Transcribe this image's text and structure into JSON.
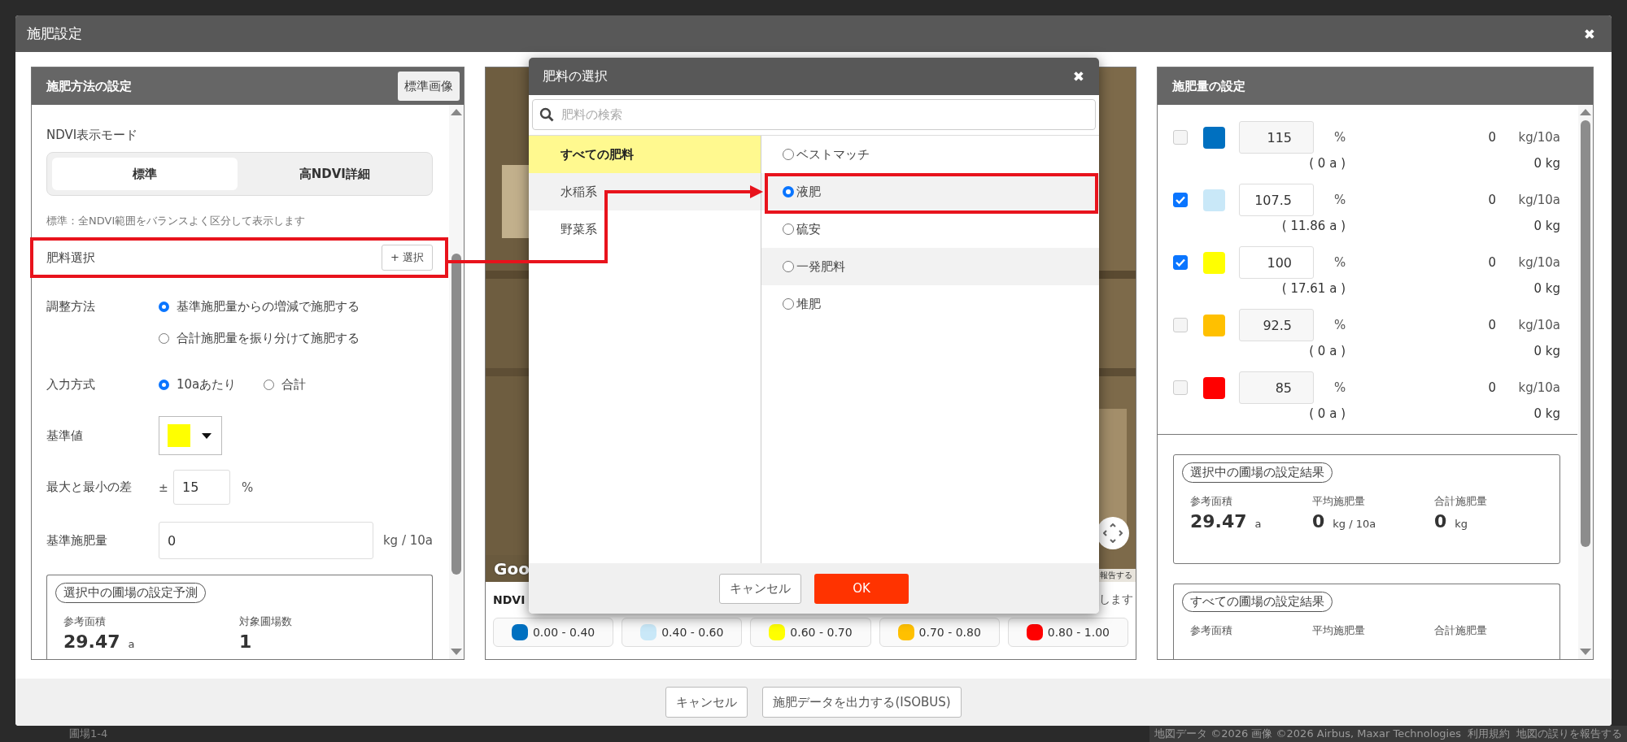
{
  "backdrop": {
    "list_item": "圃場1-4",
    "map_footer": [
      "地図データ ©2026 画像 ©2026 Airbus, Maxar Technologies",
      "利用規約",
      "地図の誤りを報告する"
    ]
  },
  "window": {
    "title": "施肥設定",
    "close": "✖"
  },
  "method_panel": {
    "title": "施肥方法の設定",
    "header_button": "標準画像",
    "ndvi_mode": {
      "label": "NDVI表示モード",
      "options": [
        {
          "label": "標準",
          "selected": true
        },
        {
          "label": "高NDVI詳細",
          "selected": false
        }
      ],
      "note": "標準：全NDVI範囲をバランスよく区分して表示します"
    },
    "fertilizer": {
      "label": "肥料選択",
      "button": "+ 選択"
    },
    "adjust": {
      "label": "調整方法",
      "options": [
        {
          "label": "基準施肥量からの増減で施肥する",
          "selected": true
        },
        {
          "label": "合計施肥量を振り分けて施肥する",
          "selected": false
        }
      ]
    },
    "input_mode": {
      "label": "入力方式",
      "options": [
        {
          "label": "10aあたり",
          "selected": true
        },
        {
          "label": "合計",
          "selected": false
        }
      ]
    },
    "base": {
      "label": "基準値",
      "color": "#ffff00"
    },
    "range": {
      "label": "最大と最小の差",
      "prefix": "±",
      "value": "15",
      "unit": "%"
    },
    "base_amount": {
      "label": "基準施肥量",
      "value": "0",
      "unit": "kg / 10a"
    },
    "forecast": {
      "title": "選択中の圃場の設定予測",
      "stats": [
        {
          "label": "参考面積",
          "value": "29.47",
          "unit": "a"
        },
        {
          "label": "対象圃場数",
          "value": "1"
        }
      ]
    }
  },
  "map_panel": {
    "kind": "picture",
    "logo": "Goo",
    "report": "報告する",
    "legend_title": "NDVI",
    "note_tail": "します",
    "ranges": [
      {
        "label": "0.00 - 0.40",
        "color": "#0070c0"
      },
      {
        "label": "0.40 - 0.60",
        "color": "#c9e8f8"
      },
      {
        "label": "0.60 - 0.70",
        "color": "#ffff00"
      },
      {
        "label": "0.70 - 0.80",
        "color": "#ffc000"
      },
      {
        "label": "0.80 - 1.00",
        "color": "#ff0000"
      }
    ]
  },
  "fertilizer_dialog": {
    "title": "肥料の選択",
    "close": "✖",
    "search_placeholder": "肥料の検索",
    "categories": [
      {
        "label": "すべての肥料",
        "selected": true
      },
      {
        "label": "水稲系",
        "selected": false
      },
      {
        "label": "野菜系",
        "selected": false
      }
    ],
    "fertilizers": [
      {
        "label": "ベストマッチ",
        "selected": false
      },
      {
        "label": "液肥",
        "selected": true
      },
      {
        "label": "硫安",
        "selected": false
      },
      {
        "label": "一発肥料",
        "selected": false
      },
      {
        "label": "堆肥",
        "selected": false
      }
    ],
    "cancel": "キャンセル",
    "ok": "OK"
  },
  "amount_panel": {
    "title": "施肥量の設定",
    "rows": [
      {
        "checked": false,
        "color": "#0070c0",
        "percent": "115",
        "percent_unit": "%",
        "area": "( 0 a )",
        "rate": "0",
        "rate_unit": "kg/10a",
        "total": "0 kg"
      },
      {
        "checked": true,
        "color": "#c9e8f8",
        "percent": "107.5",
        "percent_unit": "%",
        "area": "( 11.86 a )",
        "rate": "0",
        "rate_unit": "kg/10a",
        "total": "0 kg"
      },
      {
        "checked": true,
        "color": "#ffff00",
        "percent": "100",
        "percent_unit": "%",
        "area": "( 17.61 a )",
        "rate": "0",
        "rate_unit": "kg/10a",
        "total": "0 kg"
      },
      {
        "checked": false,
        "color": "#ffc000",
        "percent": "92.5",
        "percent_unit": "%",
        "area": "( 0 a )",
        "rate": "0",
        "rate_unit": "kg/10a",
        "total": "0 kg"
      },
      {
        "checked": false,
        "color": "#ff0000",
        "percent": "85",
        "percent_unit": "%",
        "area": "( 0 a )",
        "rate": "0",
        "rate_unit": "kg/10a",
        "total": "0 kg"
      }
    ],
    "results": [
      {
        "title": "選択中の圃場の設定結果",
        "stats": [
          {
            "label": "参考面積",
            "value": "29.47",
            "unit": "a"
          },
          {
            "label": "平均施肥量",
            "value": "0",
            "unit": "kg / 10a"
          },
          {
            "label": "合計施肥量",
            "value": "0",
            "unit": "kg"
          }
        ]
      },
      {
        "title": "すべての圃場の設定結果",
        "stats": [
          {
            "label": "参考面積"
          },
          {
            "label": "平均施肥量"
          },
          {
            "label": "合計施肥量"
          }
        ]
      }
    ]
  },
  "footer": {
    "cancel": "キャンセル",
    "export": "施肥データを出力する(ISOBUS)"
  }
}
